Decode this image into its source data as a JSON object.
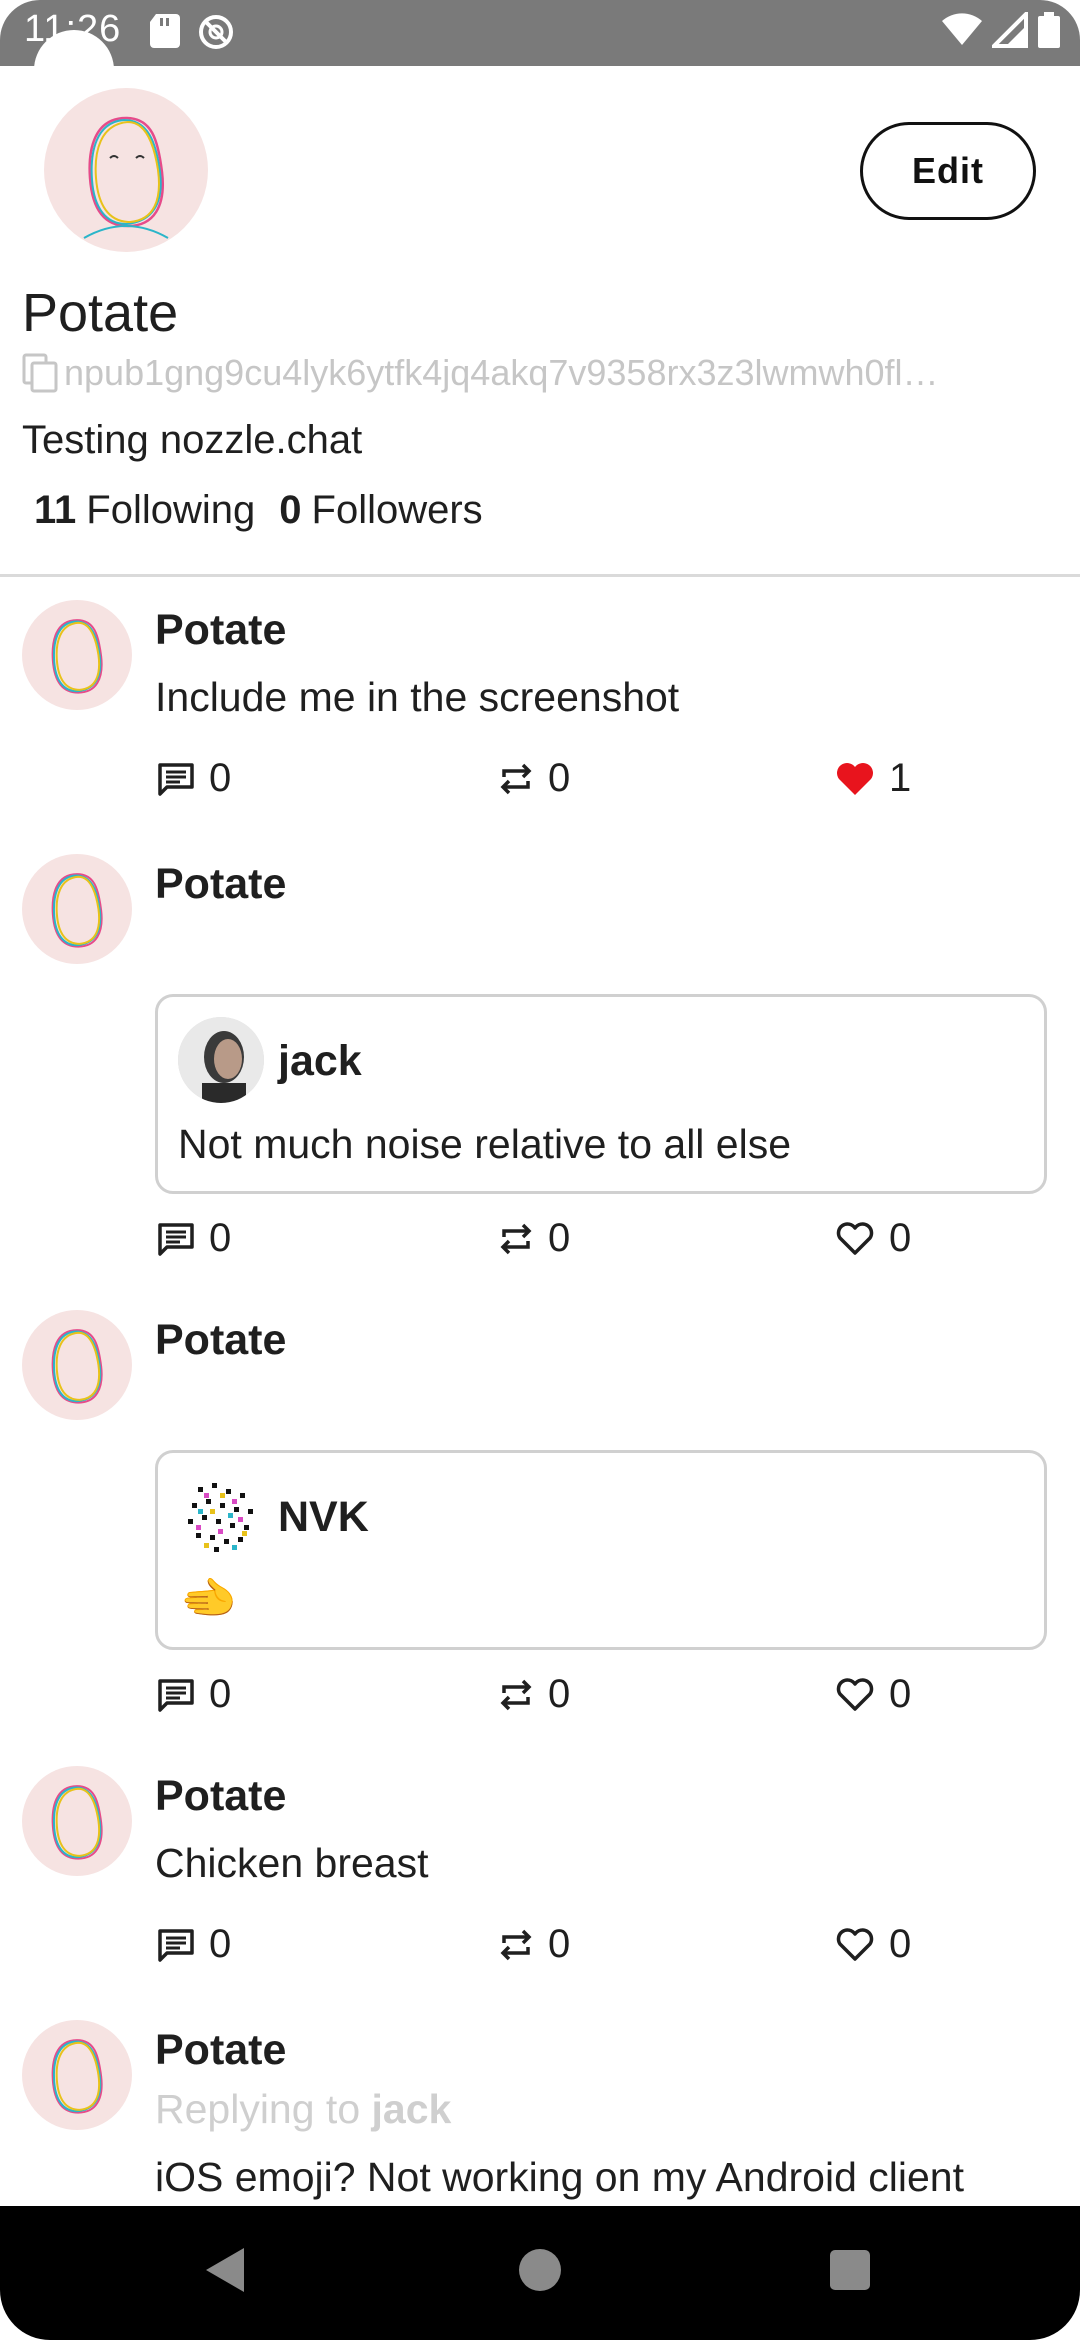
{
  "status_bar": {
    "time": "11:26"
  },
  "profile": {
    "name": "Potate",
    "pubkey": "npub1gng9cu4lyk6ytfk4jq4akq7v9358rx3z3lwmwh0fl…",
    "about": "Testing nozzle.chat",
    "following_count": "11",
    "following_label": "Following",
    "followers_count": "0",
    "followers_label": "Followers",
    "edit_label": "Edit"
  },
  "posts": [
    {
      "author": "Potate",
      "text": "Include me in the screenshot",
      "replies": "0",
      "reposts": "0",
      "likes": "1",
      "liked": true
    },
    {
      "author": "Potate",
      "quote": {
        "author": "jack",
        "text": "Not much noise relative to all else"
      },
      "replies": "0",
      "reposts": "0",
      "likes": "0"
    },
    {
      "author": "Potate",
      "quote": {
        "author": "NVK",
        "text": "🫲"
      },
      "replies": "0",
      "reposts": "0",
      "likes": "0"
    },
    {
      "author": "Potate",
      "text": "Chicken breast",
      "replies": "0",
      "reposts": "0",
      "likes": "0"
    },
    {
      "author": "Potate",
      "reply_prefix": "Replying to",
      "reply_to": "jack",
      "text": "iOS emoji? Not working on my Android client"
    }
  ],
  "colors": {
    "like_active": "#e8141d",
    "muted": "#c6c6c6",
    "avatar_bg": "#f6e3e2"
  }
}
